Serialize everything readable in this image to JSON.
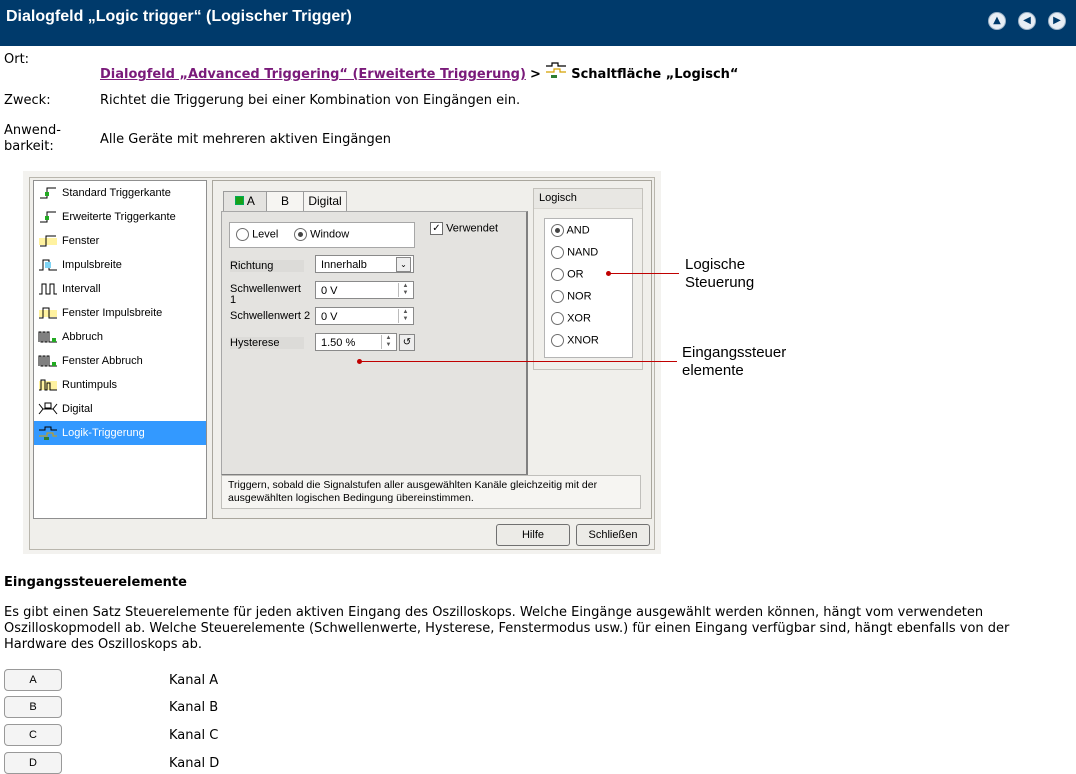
{
  "header": {
    "title": "Dialogfeld „Logic trigger“ (Logischer Trigger)"
  },
  "nav": {
    "icons": [
      "up-arrow-icon",
      "back-arrow-icon",
      "forward-arrow-icon"
    ]
  },
  "info": {
    "ort_label": "Ort:",
    "ort_link": "Dialogfeld „Advanced Triggering“ (Erweiterte Triggerung)",
    "ort_sep": ">",
    "ort_button": "Schaltfläche „Logisch“",
    "zweck_label": "Zweck:",
    "zweck_value": "Richtet die Triggerung bei einer Kombination von Eingängen ein.",
    "anwend_label1": "Anwend-",
    "anwend_label2": "barkeit:",
    "anwend_value": "Alle Geräte mit mehreren aktiven Eingängen"
  },
  "dialog": {
    "trigger_list": [
      "Standard Triggerkante",
      "Erweiterte Triggerkante",
      "Fenster",
      "Impulsbreite",
      "Intervall",
      "Fenster Impulsbreite",
      "Abbruch",
      "Fenster Abbruch",
      "Runtimpuls",
      "Digital",
      "Logik-Triggerung"
    ],
    "tabs": {
      "a": "A",
      "b": "B",
      "digital": "Digital"
    },
    "mode_level": "Level",
    "mode_window": "Window",
    "used_label": "Verwendet",
    "richtung_label": "Richtung",
    "richtung_value": "Innerhalb",
    "threshold1_label": "Schwellenwert 1",
    "threshold1_value": "0 V",
    "threshold2_label": "Schwellenwert 2",
    "threshold2_value": "0 V",
    "hysterese_label": "Hysterese",
    "hysterese_value": "1.50 %",
    "logic_title": "Logisch",
    "logic_options": [
      "AND",
      "NAND",
      "OR",
      "NOR",
      "XOR",
      "XNOR"
    ],
    "description": "Triggern, sobald die Signalstufen aller ausgewählten Kanäle gleichzeitig mit der ausgewählten logischen Bedingung übereinstimmen.",
    "help_button": "Hilfe",
    "close_button": "Schließen"
  },
  "callouts": {
    "logic_1": "Logische",
    "logic_2": "Steuerung",
    "input_1": "Eingangssteuer",
    "input_2": "elemente"
  },
  "section": {
    "heading": "Eingangssteuerelemente",
    "body": "Es gibt einen Satz Steuerelemente für jeden aktiven Eingang des Oszilloskops. Welche Eingänge ausgewählt werden können, hängt vom verwendeten Oszilloskopmodell ab. Welche Steuerelemente (Schwellenwerte, Hysterese, Fenstermodus usw.) für einen Eingang verfügbar sind, hängt ebenfalls von der Hardware des Oszilloskops ab.",
    "channels": [
      {
        "button": "A",
        "label": "Kanal A"
      },
      {
        "button": "B",
        "label": "Kanal B"
      },
      {
        "button": "C",
        "label": "Kanal C"
      },
      {
        "button": "D",
        "label": "Kanal D"
      }
    ]
  }
}
